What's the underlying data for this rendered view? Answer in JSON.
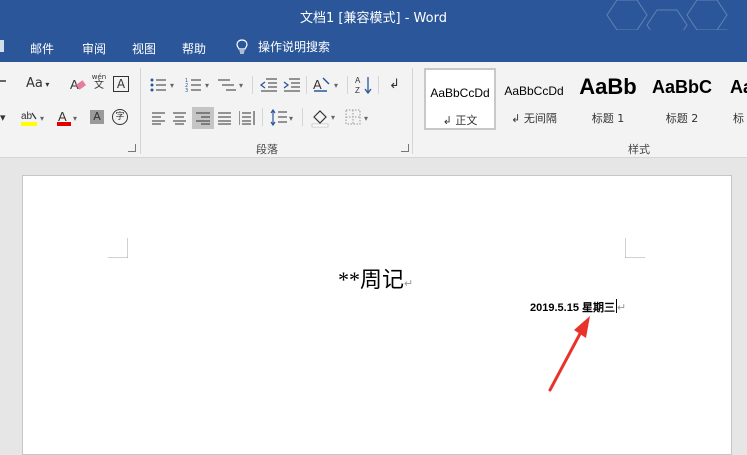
{
  "window": {
    "title": "文档1 [兼容模式]  -  Word"
  },
  "tabs": [
    {
      "label": "邮件"
    },
    {
      "label": "审阅"
    },
    {
      "label": "视图"
    },
    {
      "label": "帮助"
    }
  ],
  "tell_me": {
    "label": "操作说明搜索"
  },
  "ribbon": {
    "font_size_icon": "Aa",
    "phonetic_top": "wén",
    "phonetic_bottom": "文",
    "char_border": "A",
    "char_shading": "A",
    "enclose_char": "字",
    "paragraph_group": "段落",
    "styles_group": "样式"
  },
  "styles": [
    {
      "sample": "AaBbCcDd",
      "name": "↲ 正文"
    },
    {
      "sample": "AaBbCcDd",
      "name": "↲ 无间隔"
    },
    {
      "sample": "AaBb",
      "name": "标题 1"
    },
    {
      "sample": "AaBbC",
      "name": "标题 2"
    },
    {
      "sample": "AaB",
      "name": "标"
    }
  ],
  "document": {
    "title": "**周记",
    "date": "2019.5.15  星期三"
  },
  "colors": {
    "word_blue": "#2b579a",
    "arrow_red": "#e8332a",
    "font_color_red": "#e00000",
    "highlight_yellow": "#ffff00"
  }
}
